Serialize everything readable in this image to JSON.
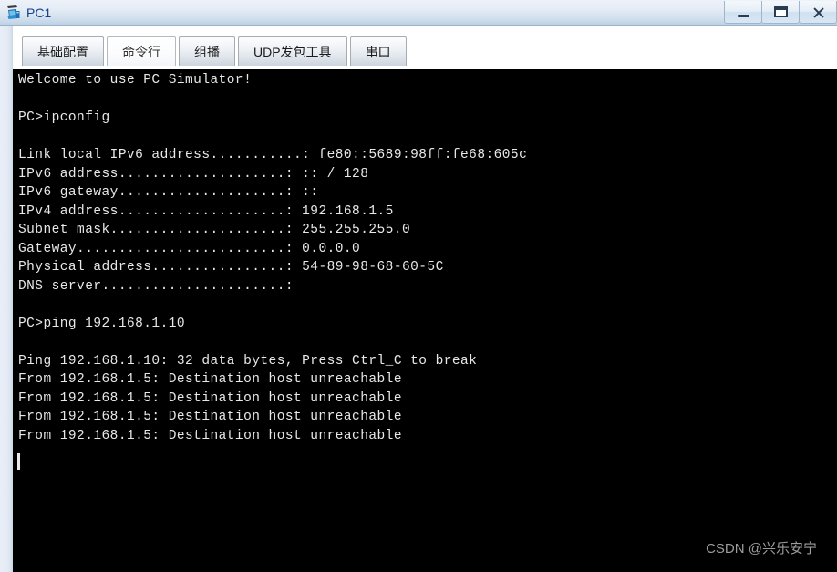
{
  "window": {
    "title": "PC1",
    "icon": "pc-host-icon",
    "controls": {
      "minimize_label": "Minimize",
      "maximize_label": "Maximize",
      "close_label": "Close"
    },
    "colors": {
      "titlebar_top": "#eef2f9",
      "titlebar_bottom": "#bed2e4",
      "title_text": "#12428c",
      "terminal_bg": "#000000",
      "terminal_fg": "#e8e8e8"
    }
  },
  "tabs": [
    {
      "label": "基础配置",
      "active": false
    },
    {
      "label": "命令行",
      "active": true
    },
    {
      "label": "组播",
      "active": false
    },
    {
      "label": "UDP发包工具",
      "active": false
    },
    {
      "label": "串口",
      "active": false
    }
  ],
  "terminal": {
    "lines": [
      "Welcome to use PC Simulator!",
      "",
      "PC>ipconfig",
      "",
      "Link local IPv6 address...........: fe80::5689:98ff:fe68:605c",
      "IPv6 address....................: :: / 128",
      "IPv6 gateway....................: ::",
      "IPv4 address....................: 192.168.1.5",
      "Subnet mask.....................: 255.255.255.0",
      "Gateway.........................: 0.0.0.0",
      "Physical address................: 54-89-98-68-60-5C",
      "DNS server......................:",
      "",
      "PC>ping 192.168.1.10",
      "",
      "Ping 192.168.1.10: 32 data bytes, Press Ctrl_C to break",
      "From 192.168.1.5: Destination host unreachable",
      "From 192.168.1.5: Destination host unreachable",
      "From 192.168.1.5: Destination host unreachable",
      "From 192.168.1.5: Destination host unreachable"
    ]
  },
  "watermark": {
    "text": "CSDN @兴乐安宁"
  }
}
